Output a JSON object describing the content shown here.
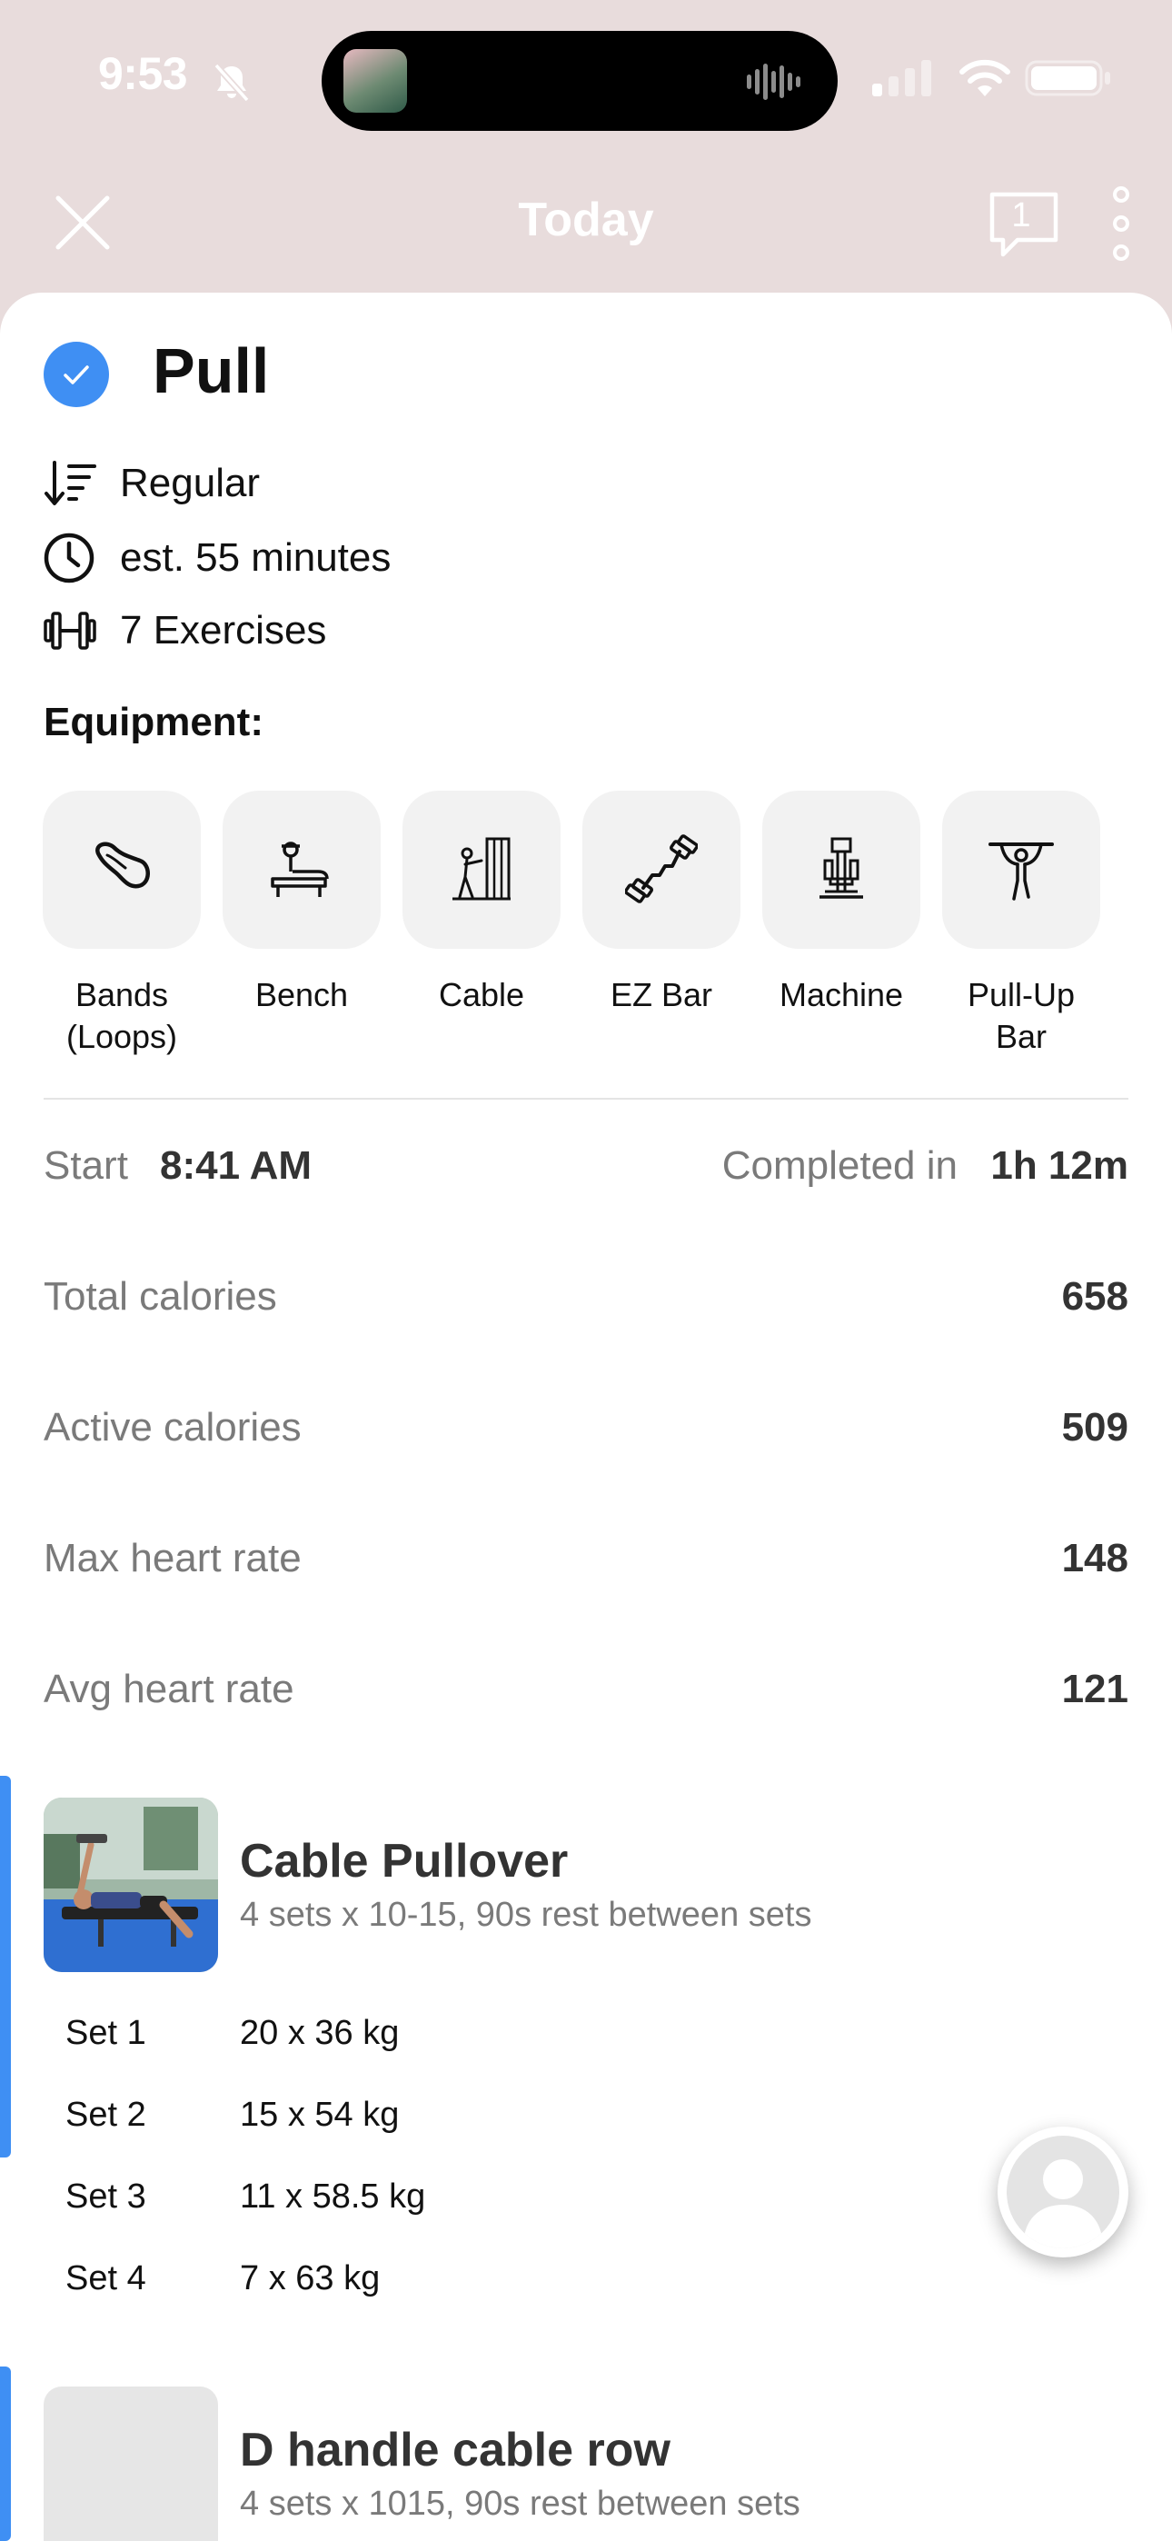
{
  "status_bar": {
    "time": "9:53"
  },
  "nav": {
    "title": "Today",
    "comment_count": "1"
  },
  "workout": {
    "title": "Pull",
    "meta": [
      {
        "icon": "sort-order-icon",
        "text": "Regular"
      },
      {
        "icon": "clock-icon",
        "text": "est. 55 minutes"
      },
      {
        "icon": "dumbbell-icon",
        "text": "7 Exercises"
      }
    ],
    "equipment_heading": "Equipment:",
    "equipment": [
      {
        "icon": "resistance-band-icon",
        "label": "Bands (Loops)"
      },
      {
        "icon": "bench-icon",
        "label": "Bench"
      },
      {
        "icon": "cable-machine-icon",
        "label": "Cable"
      },
      {
        "icon": "ez-bar-icon",
        "label": "EZ Bar"
      },
      {
        "icon": "machine-icon",
        "label": "Machine"
      },
      {
        "icon": "pull-up-bar-icon",
        "label": "Pull-Up Bar"
      }
    ]
  },
  "summary": {
    "start_label": "Start",
    "start_value": "8:41 AM",
    "completed_label": "Completed in",
    "completed_value": "1h 12m",
    "stats": [
      {
        "label": "Total calories",
        "value": "658"
      },
      {
        "label": "Active calories",
        "value": "509"
      },
      {
        "label": "Max heart rate",
        "value": "148"
      },
      {
        "label": "Avg heart rate",
        "value": "121"
      }
    ]
  },
  "exercises": [
    {
      "name": "Cable Pullover",
      "detail": "4 sets x 10-15, 90s rest between sets",
      "sets": [
        {
          "label": "Set 1",
          "value": "20 x 36 kg"
        },
        {
          "label": "Set 2",
          "value": "15 x 54 kg"
        },
        {
          "label": "Set 3",
          "value": "11 x 58.5 kg"
        },
        {
          "label": "Set 4",
          "value": "7 x 63 kg"
        }
      ]
    },
    {
      "name": "D handle cable row",
      "detail": "4 sets x 1015, 90s rest between sets"
    }
  ],
  "colors": {
    "accent": "#3f8ff3",
    "header_bg": "#e8dcdc",
    "muted_text": "#7a7a7a"
  }
}
